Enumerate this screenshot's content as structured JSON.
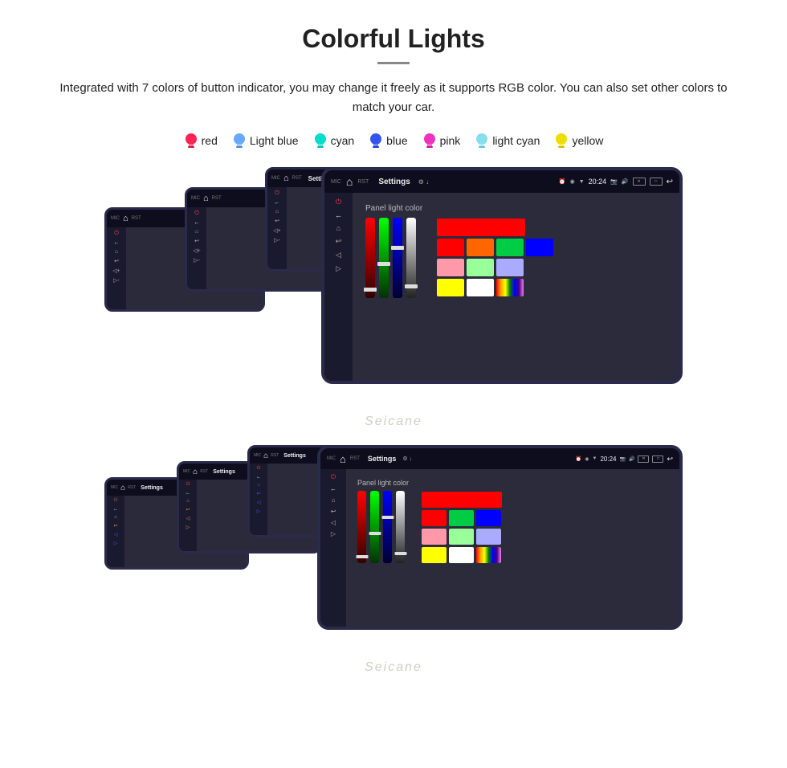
{
  "page": {
    "title": "Colorful Lights",
    "description": "Integrated with 7 colors of button indicator, you may change it freely as it supports RGB color. You can also set other colors to match your car.",
    "watermark": "Seicane",
    "colors": [
      {
        "name": "red",
        "color": "#ff3366",
        "bulb_color": "#ff2255"
      },
      {
        "name": "Light blue",
        "color": "#88ccff",
        "bulb_color": "#66aaff"
      },
      {
        "name": "cyan",
        "color": "#00ffee",
        "bulb_color": "#00ddcc"
      },
      {
        "name": "blue",
        "color": "#4466ff",
        "bulb_color": "#3355ee"
      },
      {
        "name": "pink",
        "color": "#ff44cc",
        "bulb_color": "#ee33bb"
      },
      {
        "name": "light cyan",
        "color": "#aaeeff",
        "bulb_color": "#88ddee"
      },
      {
        "name": "yellow",
        "color": "#ffee00",
        "bulb_color": "#eedd00"
      }
    ],
    "panel_label": "Panel light color",
    "settings_label": "Settings",
    "back_label": "←",
    "time": "20:24"
  }
}
